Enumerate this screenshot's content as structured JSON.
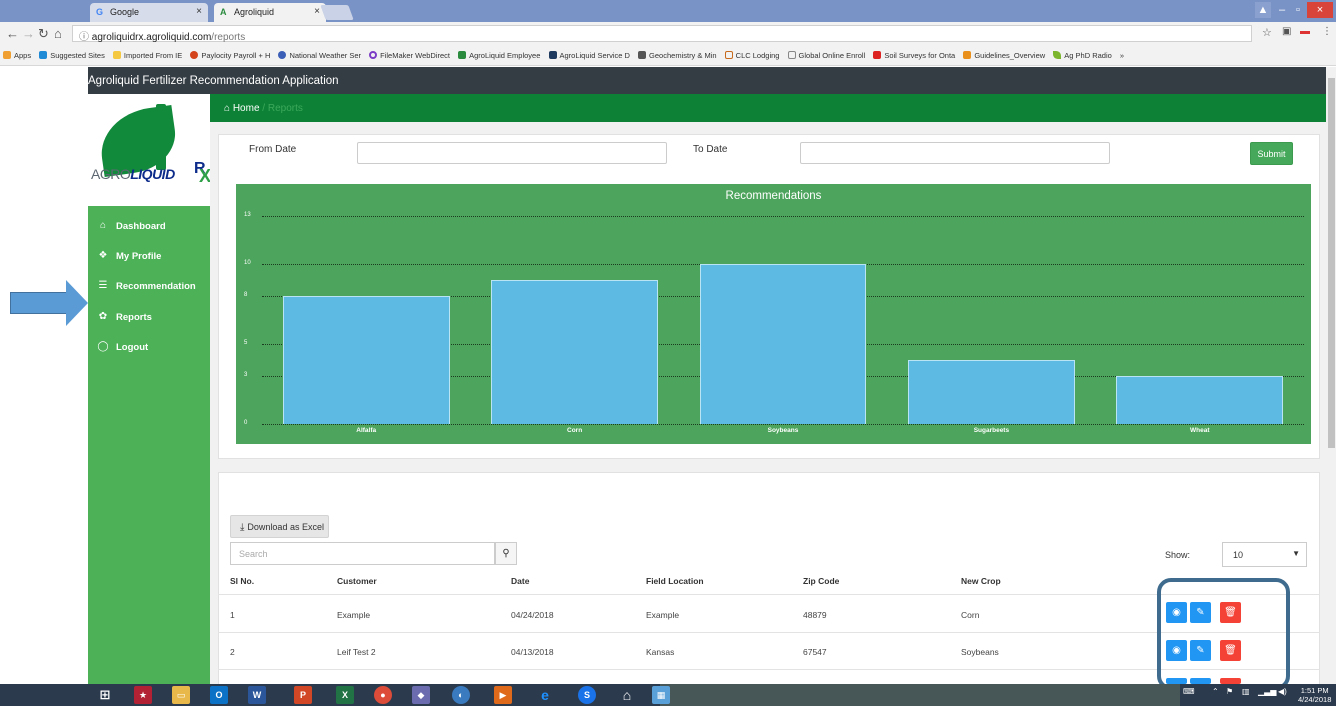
{
  "browser": {
    "tabs": [
      {
        "label": "Google",
        "icon": "G"
      },
      {
        "label": "Agroliquid",
        "icon": "A"
      }
    ],
    "url_domain": "agroliquidrx.agroliquid.com",
    "url_path": "/reports",
    "bookmarks": [
      "Apps",
      "Suggested Sites",
      "Imported From IE",
      "Paylocity Payroll + H",
      "National Weather Ser",
      "FileMaker WebDirect",
      "AgroLiquid Employee",
      "AgroLiquid Service D",
      "Geochemistry & Min",
      "CLC Lodging",
      "Global Online Enroll",
      "Soil Surveys for Onta",
      "Guidelines_Overview",
      "Ag PhD Radio"
    ],
    "bookmark_more": "»"
  },
  "app": {
    "title": "Agroliquid Fertilizer Recommendation Application",
    "breadcrumb": {
      "home": "Home",
      "separator": "/",
      "current": "Reports"
    },
    "logo": {
      "prefix": "AGRO",
      "brand": "LIQUID",
      "rx_r": "R",
      "rx_x": "X"
    }
  },
  "sidebar": {
    "items": [
      {
        "label": "Dashboard",
        "icon": "⌂"
      },
      {
        "label": "My Profile",
        "icon": "❖"
      },
      {
        "label": "Recommendation",
        "icon": "☰"
      },
      {
        "label": "Reports",
        "icon": "✿"
      },
      {
        "label": "Logout",
        "icon": "◯"
      }
    ]
  },
  "filters": {
    "from_label": "From Date",
    "to_label": "To Date",
    "submit": "Submit"
  },
  "chart_data": {
    "type": "bar",
    "title": "Recommendations",
    "categories": [
      "Alfalfa",
      "Corn",
      "Soybeans",
      "Sugarbeets",
      "Wheat"
    ],
    "values": [
      8,
      9,
      10,
      4,
      3
    ],
    "y_ticks": [
      "0",
      "3",
      "5",
      "8",
      "10",
      "13"
    ],
    "ylim": [
      0,
      13
    ],
    "grid": true,
    "bar_color": "#5dbae3",
    "background": "#4da45c"
  },
  "table": {
    "download_label": "Download as Excel",
    "search_placeholder": "Search",
    "show_label": "Show:",
    "show_value": "10",
    "columns": [
      "Sl No.",
      "Customer",
      "Date",
      "Field Location",
      "Zip Code",
      "New Crop"
    ],
    "rows": [
      {
        "sl": "1",
        "customer": "Example",
        "date": "04/24/2018",
        "location": "Example",
        "zip": "48879",
        "crop": "Corn"
      },
      {
        "sl": "2",
        "customer": "Leif Test 2",
        "date": "04/13/2018",
        "location": "Kansas",
        "zip": "67547",
        "crop": "Soybeans"
      }
    ]
  },
  "taskbar": {
    "time": "1:51 PM",
    "date": "4/24/2018"
  },
  "colors": {
    "header_dark": "#343d44",
    "breadcrumb_green": "#0d8236",
    "sidebar_green": "#4cb157",
    "action_blue": "#2196f3",
    "action_red": "#f44336"
  }
}
